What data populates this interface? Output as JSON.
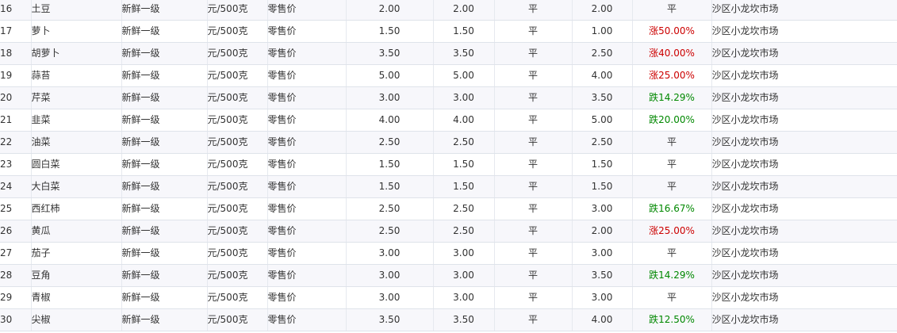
{
  "rows": [
    {
      "id": "16",
      "name": "土豆",
      "grade": "新鲜一级",
      "unit": "元/500克",
      "price_type": "零售价",
      "price1": "2.00",
      "price2": "2.00",
      "trend": "平",
      "prev": "2.00",
      "change": "平",
      "change_dir": "flat",
      "market": "沙区小龙坎市场"
    },
    {
      "id": "17",
      "name": "萝卜",
      "grade": "新鲜一级",
      "unit": "元/500克",
      "price_type": "零售价",
      "price1": "1.50",
      "price2": "1.50",
      "trend": "平",
      "prev": "1.00",
      "change": "涨50.00%",
      "change_dir": "up",
      "market": "沙区小龙坎市场"
    },
    {
      "id": "18",
      "name": "胡萝卜",
      "grade": "新鲜一级",
      "unit": "元/500克",
      "price_type": "零售价",
      "price1": "3.50",
      "price2": "3.50",
      "trend": "平",
      "prev": "2.50",
      "change": "涨40.00%",
      "change_dir": "up",
      "market": "沙区小龙坎市场"
    },
    {
      "id": "19",
      "name": "蒜苔",
      "grade": "新鲜一级",
      "unit": "元/500克",
      "price_type": "零售价",
      "price1": "5.00",
      "price2": "5.00",
      "trend": "平",
      "prev": "4.00",
      "change": "涨25.00%",
      "change_dir": "up",
      "market": "沙区小龙坎市场"
    },
    {
      "id": "20",
      "name": "芹菜",
      "grade": "新鲜一级",
      "unit": "元/500克",
      "price_type": "零售价",
      "price1": "3.00",
      "price2": "3.00",
      "trend": "平",
      "prev": "3.50",
      "change": "跌14.29%",
      "change_dir": "down",
      "market": "沙区小龙坎市场"
    },
    {
      "id": "21",
      "name": "韭菜",
      "grade": "新鲜一级",
      "unit": "元/500克",
      "price_type": "零售价",
      "price1": "4.00",
      "price2": "4.00",
      "trend": "平",
      "prev": "5.00",
      "change": "跌20.00%",
      "change_dir": "down",
      "market": "沙区小龙坎市场"
    },
    {
      "id": "22",
      "name": "油菜",
      "grade": "新鲜一级",
      "unit": "元/500克",
      "price_type": "零售价",
      "price1": "2.50",
      "price2": "2.50",
      "trend": "平",
      "prev": "2.50",
      "change": "平",
      "change_dir": "flat",
      "market": "沙区小龙坎市场"
    },
    {
      "id": "23",
      "name": "圆白菜",
      "grade": "新鲜一级",
      "unit": "元/500克",
      "price_type": "零售价",
      "price1": "1.50",
      "price2": "1.50",
      "trend": "平",
      "prev": "1.50",
      "change": "平",
      "change_dir": "flat",
      "market": "沙区小龙坎市场"
    },
    {
      "id": "24",
      "name": "大白菜",
      "grade": "新鲜一级",
      "unit": "元/500克",
      "price_type": "零售价",
      "price1": "1.50",
      "price2": "1.50",
      "trend": "平",
      "prev": "1.50",
      "change": "平",
      "change_dir": "flat",
      "market": "沙区小龙坎市场"
    },
    {
      "id": "25",
      "name": "西红柿",
      "grade": "新鲜一级",
      "unit": "元/500克",
      "price_type": "零售价",
      "price1": "2.50",
      "price2": "2.50",
      "trend": "平",
      "prev": "3.00",
      "change": "跌16.67%",
      "change_dir": "down",
      "market": "沙区小龙坎市场"
    },
    {
      "id": "26",
      "name": "黄瓜",
      "grade": "新鲜一级",
      "unit": "元/500克",
      "price_type": "零售价",
      "price1": "2.50",
      "price2": "2.50",
      "trend": "平",
      "prev": "2.00",
      "change": "涨25.00%",
      "change_dir": "up",
      "market": "沙区小龙坎市场"
    },
    {
      "id": "27",
      "name": "茄子",
      "grade": "新鲜一级",
      "unit": "元/500克",
      "price_type": "零售价",
      "price1": "3.00",
      "price2": "3.00",
      "trend": "平",
      "prev": "3.00",
      "change": "平",
      "change_dir": "flat",
      "market": "沙区小龙坎市场"
    },
    {
      "id": "28",
      "name": "豆角",
      "grade": "新鲜一级",
      "unit": "元/500克",
      "price_type": "零售价",
      "price1": "3.00",
      "price2": "3.00",
      "trend": "平",
      "prev": "3.50",
      "change": "跌14.29%",
      "change_dir": "down",
      "market": "沙区小龙坎市场"
    },
    {
      "id": "29",
      "name": "青椒",
      "grade": "新鲜一级",
      "unit": "元/500克",
      "price_type": "零售价",
      "price1": "3.00",
      "price2": "3.00",
      "trend": "平",
      "prev": "3.00",
      "change": "平",
      "change_dir": "flat",
      "market": "沙区小龙坎市场"
    },
    {
      "id": "30",
      "name": "尖椒",
      "grade": "新鲜一级",
      "unit": "元/500克",
      "price_type": "零售价",
      "price1": "3.50",
      "price2": "3.50",
      "trend": "平",
      "prev": "4.00",
      "change": "跌12.50%",
      "change_dir": "down",
      "market": "沙区小龙坎市场"
    }
  ]
}
